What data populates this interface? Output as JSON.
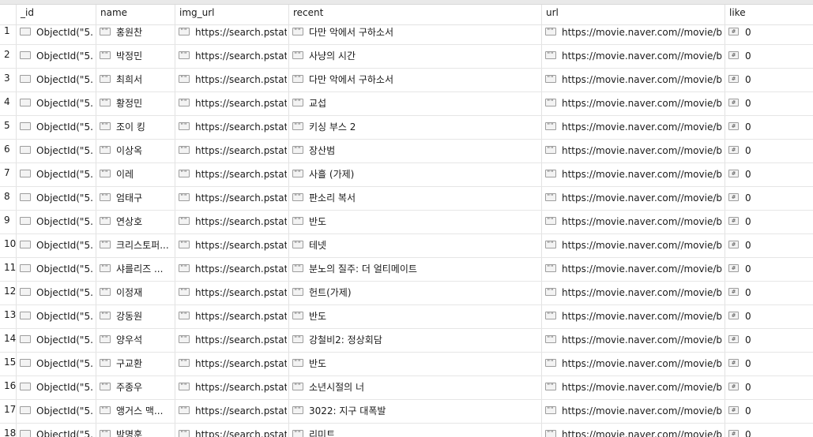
{
  "columns": [
    "_id",
    "name",
    "img_url",
    "recent",
    "url",
    "like"
  ],
  "icons": {
    "objectid": "objectid-type-icon",
    "string": "string-type-icon",
    "number": "number-type-icon"
  },
  "string_icon_glyph": "\"\"",
  "number_icon_glyph": "#",
  "rows": [
    {
      "num": "1",
      "id": "ObjectId(\"5...",
      "name": "홍원찬",
      "img_url": "https://search.pstati...",
      "recent": "다만 악에서 구하소서",
      "url": "https://movie.naver.com//movie/bi...",
      "like": "0"
    },
    {
      "num": "2",
      "id": "ObjectId(\"5...",
      "name": "박정민",
      "img_url": "https://search.pstati...",
      "recent": "사냥의 시간",
      "url": "https://movie.naver.com//movie/bi...",
      "like": "0"
    },
    {
      "num": "3",
      "id": "ObjectId(\"5...",
      "name": "최희서",
      "img_url": "https://search.pstati...",
      "recent": "다만 악에서 구하소서",
      "url": "https://movie.naver.com//movie/bi...",
      "like": "0"
    },
    {
      "num": "4",
      "id": "ObjectId(\"5...",
      "name": "황정민",
      "img_url": "https://search.pstati...",
      "recent": "교섭",
      "url": "https://movie.naver.com//movie/bi...",
      "like": "0"
    },
    {
      "num": "5",
      "id": "ObjectId(\"5...",
      "name": "조이 킹",
      "img_url": "https://search.pstati...",
      "recent": "키싱 부스 2",
      "url": "https://movie.naver.com//movie/bi...",
      "like": "0"
    },
    {
      "num": "6",
      "id": "ObjectId(\"5...",
      "name": "이상옥",
      "img_url": "https://search.pstati...",
      "recent": "장산범",
      "url": "https://movie.naver.com//movie/bi...",
      "like": "0"
    },
    {
      "num": "7",
      "id": "ObjectId(\"5...",
      "name": "이레",
      "img_url": "https://search.pstati...",
      "recent": "사흘 (가제)",
      "url": "https://movie.naver.com//movie/bi...",
      "like": "0"
    },
    {
      "num": "8",
      "id": "ObjectId(\"5...",
      "name": "엄태구",
      "img_url": "https://search.pstati...",
      "recent": "판소리 복서",
      "url": "https://movie.naver.com//movie/bi...",
      "like": "0"
    },
    {
      "num": "9",
      "id": "ObjectId(\"5...",
      "name": "연상호",
      "img_url": "https://search.pstati...",
      "recent": "반도",
      "url": "https://movie.naver.com//movie/bi...",
      "like": "0"
    },
    {
      "num": "10",
      "id": "ObjectId(\"5...",
      "name": "크리스토퍼...",
      "img_url": "https://search.pstati...",
      "recent": "테넷",
      "url": "https://movie.naver.com//movie/bi...",
      "like": "0"
    },
    {
      "num": "11",
      "id": "ObjectId(\"5...",
      "name": "샤를리즈 ...",
      "img_url": "https://search.pstati...",
      "recent": "분노의 질주: 더 얼티메이트",
      "url": "https://movie.naver.com//movie/bi...",
      "like": "0"
    },
    {
      "num": "12",
      "id": "ObjectId(\"5...",
      "name": "이정재",
      "img_url": "https://search.pstati...",
      "recent": "헌트(가제)",
      "url": "https://movie.naver.com//movie/bi...",
      "like": "0"
    },
    {
      "num": "13",
      "id": "ObjectId(\"5...",
      "name": "강동원",
      "img_url": "https://search.pstati...",
      "recent": "반도",
      "url": "https://movie.naver.com//movie/bi...",
      "like": "0"
    },
    {
      "num": "14",
      "id": "ObjectId(\"5...",
      "name": "양우석",
      "img_url": "https://search.pstati...",
      "recent": "강철비2: 정상회담",
      "url": "https://movie.naver.com//movie/bi...",
      "like": "0"
    },
    {
      "num": "15",
      "id": "ObjectId(\"5...",
      "name": "구교환",
      "img_url": "https://search.pstati...",
      "recent": "반도",
      "url": "https://movie.naver.com//movie/bi...",
      "like": "0"
    },
    {
      "num": "16",
      "id": "ObjectId(\"5...",
      "name": "주종우",
      "img_url": "https://search.pstati...",
      "recent": "소년시절의 너",
      "url": "https://movie.naver.com//movie/bi...",
      "like": "0"
    },
    {
      "num": "17",
      "id": "ObjectId(\"5...",
      "name": "앵거스 맥...",
      "img_url": "https://search.pstati...",
      "recent": "3022: 지구 대폭발",
      "url": "https://movie.naver.com//movie/bi...",
      "like": "0"
    },
    {
      "num": "18",
      "id": "ObjectId(\"5...",
      "name": "박명훈",
      "img_url": "https://search.pstati...",
      "recent": "리미트",
      "url": "https://movie.naver.com//movie/bi...",
      "like": "0"
    }
  ]
}
